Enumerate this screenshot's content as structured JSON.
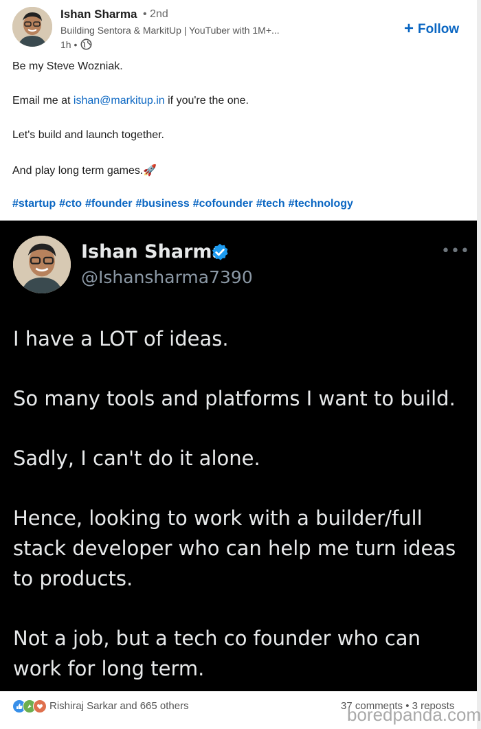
{
  "post": {
    "author": {
      "name": "Ishan Sharma",
      "degree": "• 2nd",
      "headline": "Building Sentora & MarkitUp | YouTuber with 1M+...",
      "time": "1h •"
    },
    "follow_label": "Follow",
    "body": {
      "line1": "Be my Steve Wozniak.",
      "line2_prefix": "Email me at ",
      "email": "ishan@markitup.in",
      "line2_suffix": " if you're the one.",
      "line3": "Let's build and launch together.",
      "line4": "And play long term games.🚀"
    },
    "hashtags": [
      "#startup",
      "#cto",
      "#founder",
      "#business",
      "#cofounder",
      "#tech",
      "#technology"
    ]
  },
  "tweet": {
    "name": "Ishan Sharma",
    "handle": "@Ishansharma7390",
    "more": "•••",
    "lines": [
      "I have a LOT of ideas.",
      "So many tools and platforms I want to build.",
      "Sadly, I can't do it alone.",
      "Hence, looking to work with a builder/full",
      "stack developer who can help me turn ideas",
      "to products.",
      "Not a job, but a tech co founder who can",
      "work for long term."
    ]
  },
  "footer": {
    "reactors": "Rishiraj Sarkar and 665 others",
    "stats": "37 comments • 3 reposts"
  },
  "watermark": "boredpanda.com",
  "colors": {
    "link": "#0a66c2",
    "tweet_bg": "#000000",
    "verified": "#1d9bf0"
  }
}
